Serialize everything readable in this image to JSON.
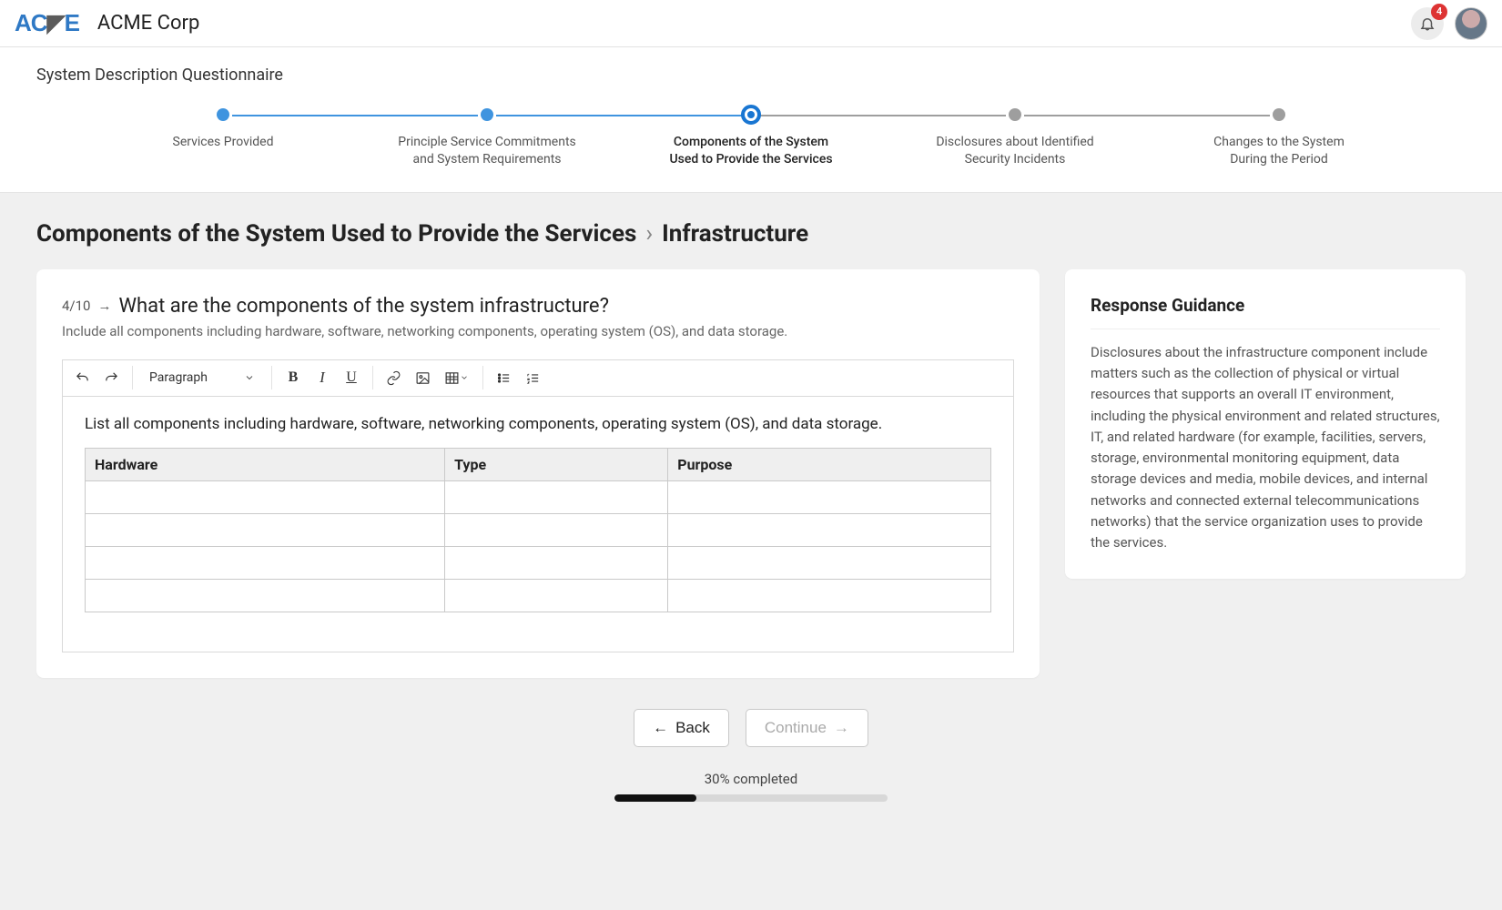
{
  "header": {
    "logo_text": "AC▙E",
    "company": "ACME Corp",
    "notification_count": 4
  },
  "stepper": {
    "title": "System Description Questionnaire",
    "steps": [
      {
        "label": "Services Provided",
        "state": "done"
      },
      {
        "label": "Principle Service Commitments\nand System Requirements",
        "state": "done"
      },
      {
        "label": "Components of the System\nUsed to Provide the Services",
        "state": "current"
      },
      {
        "label": "Disclosures about Identified\nSecurity Incidents",
        "state": "todo"
      },
      {
        "label": "Changes to the System\nDuring the Period",
        "state": "todo"
      }
    ]
  },
  "breadcrumb": {
    "section": "Components of the System Used to Provide the Services",
    "page": "Infrastructure"
  },
  "question": {
    "counter": "4/10",
    "title": "What are the components of the system infrastructure?",
    "description": "Include all components including hardware, software, networking components, operating system (OS), and data storage."
  },
  "editor": {
    "format_label": "Paragraph",
    "intro": "List all components including hardware, software, networking components, operating system (OS), and data storage.",
    "columns": [
      "Hardware",
      "Type",
      "Purpose"
    ],
    "rows": [
      [
        "",
        "",
        ""
      ],
      [
        "",
        "",
        ""
      ],
      [
        "",
        "",
        ""
      ],
      [
        "",
        "",
        ""
      ]
    ]
  },
  "guidance": {
    "title": "Response Guidance",
    "body": "Disclosures about the infrastructure component include matters such as the collection of physical or virtual resources that supports an overall IT environment, including the physical environment and related structures, IT, and related hardware (for example, facilities, servers, storage, environmental monitoring equipment, data storage devices and media, mobile devices, and internal networks and connected external telecommunications networks) that the service organization uses to provide the services."
  },
  "nav": {
    "back": "Back",
    "continue": "Continue"
  },
  "progress": {
    "label": "30% completed",
    "percent": 30
  }
}
